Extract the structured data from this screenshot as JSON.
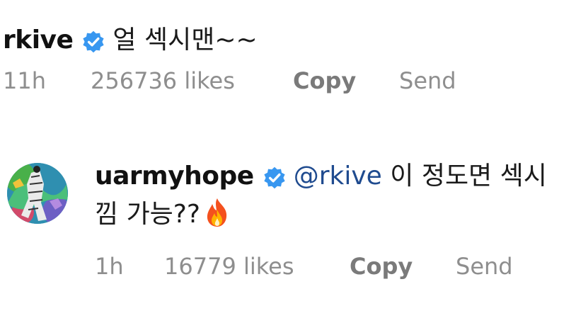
{
  "comments": [
    {
      "username": "rkive",
      "verified": true,
      "text": "얼 섹시맨~~",
      "time": "11h",
      "likes": "256736 likes",
      "copy_label": "Copy",
      "send_label": "Send"
    },
    {
      "username": "uarmyhope",
      "verified": true,
      "mention": "@rkive",
      "text_line1": " 이 정도면 섹시",
      "text_line2": "낌 가능??",
      "emoji": "fire-emoji",
      "time": "1h",
      "likes": "16779 likes",
      "copy_label": "Copy",
      "send_label": "Send"
    }
  ],
  "colors": {
    "verified_badge": "#3897f0",
    "mention": "#1f4b8f",
    "meta_text": "#8e8e8e"
  }
}
